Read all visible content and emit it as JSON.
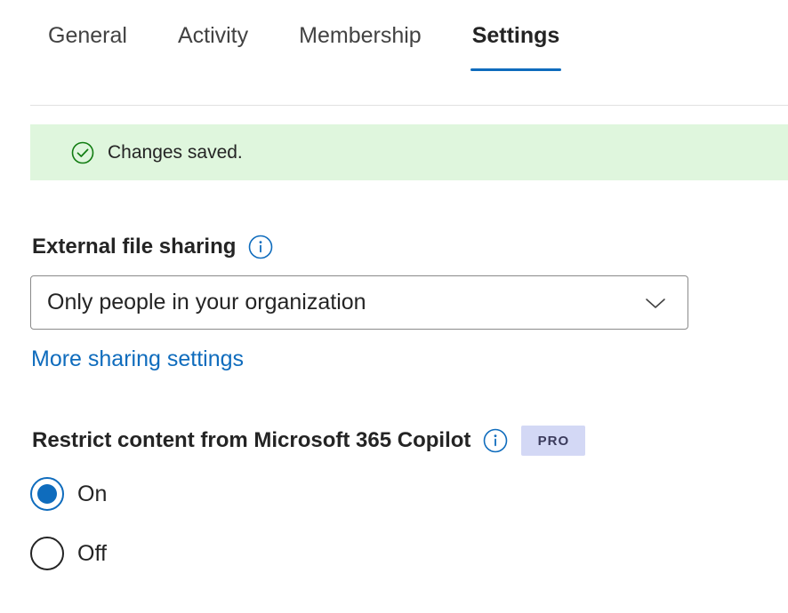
{
  "tabs": [
    {
      "label": "General"
    },
    {
      "label": "Activity"
    },
    {
      "label": "Membership"
    },
    {
      "label": "Settings"
    }
  ],
  "banner": {
    "message": "Changes saved."
  },
  "external_sharing": {
    "label": "External file sharing",
    "selected": "Only people in your organization"
  },
  "more_sharing_link": "More sharing settings",
  "copilot": {
    "label": "Restrict content from Microsoft 365 Copilot",
    "badge": "PRO",
    "options": [
      {
        "label": "On",
        "checked": true
      },
      {
        "label": "Off",
        "checked": false
      }
    ]
  },
  "colors": {
    "accent": "#0f6cbd",
    "success_bg": "#dff6dd",
    "success_icon": "#107c10",
    "badge_bg": "#d3d8f5"
  },
  "icons": {
    "banner": "check-circle-icon",
    "info": "info-icon",
    "dropdown": "chevron-down-icon"
  }
}
